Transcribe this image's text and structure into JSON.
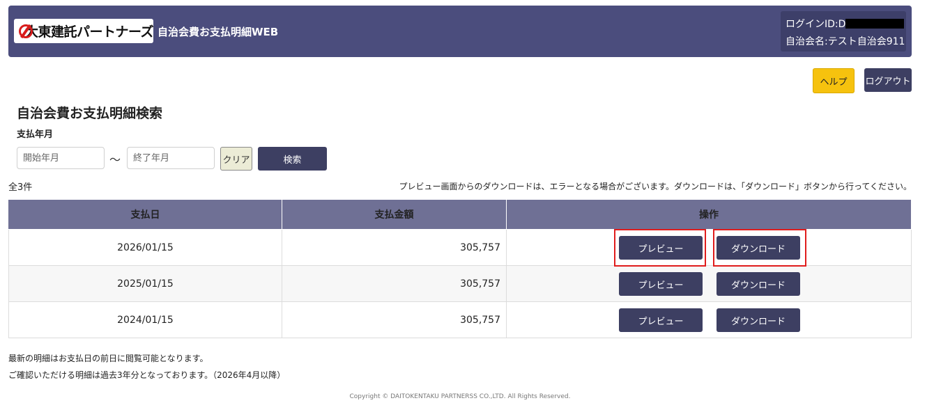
{
  "header": {
    "logo_text": "大東建託パートナーズ",
    "app_title": "自治会費お支払明細WEB",
    "login_label": "ログインID:D",
    "association_label": "自治会名:テスト自治会911",
    "help_label": "ヘルプ",
    "logout_label": "ログアウト"
  },
  "search": {
    "title": "自治会費お支払明細検索",
    "period_label": "支払年月",
    "start_placeholder": "開始年月",
    "separator": "〜",
    "end_placeholder": "終了年月",
    "clear_label": "クリア",
    "search_label": "検索"
  },
  "results": {
    "count": "全3件",
    "notice": "プレビュー画面からのダウンロードは、エラーとなる場合がございます。ダウンロードは、「ダウンロード」ボタンから行ってください。",
    "columns": [
      "支払日",
      "支払金額",
      "操作"
    ],
    "rows": [
      {
        "date": "2026/01/15",
        "amount": "305,757",
        "preview": "プレビュー",
        "download": "ダウンロード"
      },
      {
        "date": "2025/01/15",
        "amount": "305,757",
        "preview": "プレビュー",
        "download": "ダウンロード"
      },
      {
        "date": "2024/01/15",
        "amount": "305,757",
        "preview": "プレビュー",
        "download": "ダウンロード"
      }
    ]
  },
  "footnotes": [
    "最新の明細はお支払日の前日に閲覧可能となります。",
    "ご確認いただける明細は過去3年分となっております。（2026年4月以降）"
  ],
  "copyright": "Copyright © DAITOKENTAKU PARTNERSS CO.,LTD. All Rights Reserved.",
  "colors": {
    "header_bg": "#4b4d7d",
    "button_dark": "#3d3f62",
    "help_yellow": "#f6c20e",
    "table_header": "#6f7095",
    "highlight_red": "#e01c1c",
    "logo_red": "#d81c1c"
  }
}
